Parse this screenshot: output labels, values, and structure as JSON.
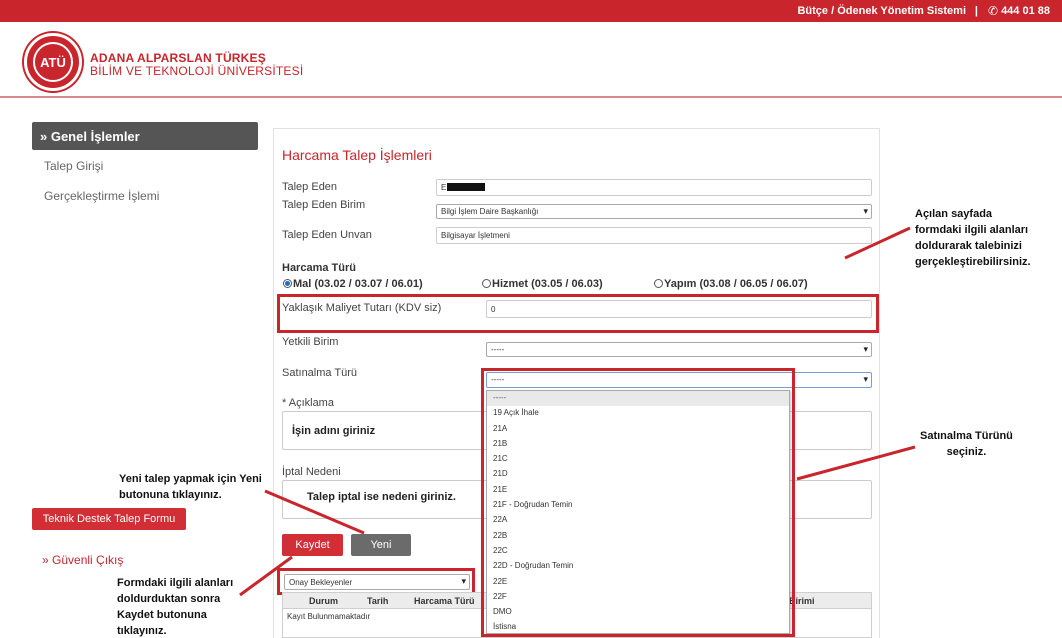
{
  "topbar": {
    "system_name": "Bütçe / Ödenek Yönetim Sistemi",
    "separator": "|",
    "phone": "444 01 88",
    "phone_icon": "phone-icon"
  },
  "header": {
    "logo_text": "ATÜ",
    "university_line1": "ADANA ALPARSLAN TÜRKEŞ",
    "university_line2": "BİLİM VE TEKNOLOJİ ÜNİVERSİTESİ"
  },
  "sidebar": {
    "section": "» Genel İşlemler",
    "items": [
      {
        "label": "Talep Girişi"
      },
      {
        "label": "Gerçekleştirme İşlemi"
      }
    ],
    "support_button": "Teknik Destek Talep Formu",
    "logout": "» Güvenli Çıkış"
  },
  "form": {
    "title": "Harcama Talep İşlemleri",
    "requester_label": "Talep Eden",
    "requester_value": "E",
    "requester_unit_label": "Talep Eden Birim",
    "requester_unit_value": "Bilgi İşlem Daire Başkanlığı",
    "requester_title_label": "Talep Eden Unvan",
    "requester_title_value": "Bilgisayar İşletmeni",
    "spend_type_label": "Harcama Türü",
    "radios": [
      {
        "label": "Mal (03.02 / 03.07 / 06.01)",
        "checked": true
      },
      {
        "label": "Hizmet (03.05 / 06.03)",
        "checked": false
      },
      {
        "label": "Yapım (03.08 / 06.05 / 06.07)",
        "checked": false
      }
    ],
    "cost_label": "Yaklaşık Maliyet Tutarı (KDV siz)",
    "cost_value": "0",
    "authorized_unit_label": "Yetkili Birim",
    "authorized_unit_value": "-----",
    "purchase_type_label": "Satınalma Türü",
    "purchase_type_value": "-----",
    "description_label": "* Açıklama",
    "description_hint": "İşin adını giriniz",
    "cancel_reason_label": "İptal Nedeni",
    "cancel_reason_hint": "Talep iptal ise nedeni giriniz.",
    "save_button": "Kaydet",
    "new_button": "Yeni",
    "filter_value": "Onay Bekleyenler"
  },
  "grid": {
    "columns": [
      "Durum",
      "Tarih",
      "Harcama Türü",
      "Birimi"
    ],
    "empty_text": "Kayıt Bulunmamaktadır"
  },
  "dropdown": {
    "options": [
      "-----",
      "19 Açık İhale",
      "21A",
      "21B",
      "21C",
      "21D",
      "21E",
      "21F - Doğrudan Temin",
      "22A",
      "22B",
      "22C",
      "22D - Doğrudan Temin",
      "22E",
      "22F",
      "DMO",
      "İstisna"
    ]
  },
  "callouts": {
    "form_fill": [
      "Açılan sayfada",
      "formdaki ilgili alanları",
      "doldurarak talebinizi",
      "gerçekleştirebilirsiniz."
    ],
    "purchase_type": [
      "Satınalma Türünü",
      "seçiniz."
    ],
    "new_request": [
      "Yeni talep yapmak için Yeni",
      "butonuna tıklayınız."
    ],
    "save": [
      "Formdaki ilgili alanları",
      "doldurduktan sonra",
      "Kaydet butonuna",
      "tıklayınız."
    ]
  },
  "colors": {
    "brand_red": "#c8252c",
    "sidebar_dark": "#555555",
    "button_gray": "#6b6b6b"
  }
}
